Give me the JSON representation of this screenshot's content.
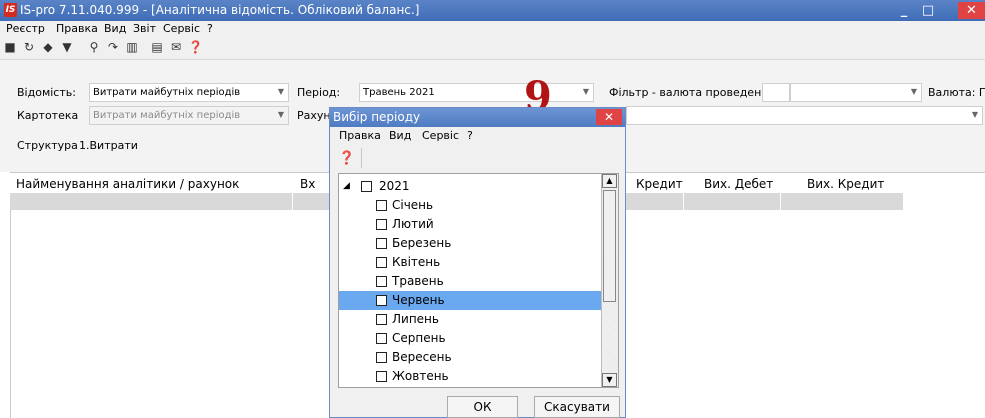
{
  "window": {
    "app_badge": "IS",
    "title": "IS-pro 7.11.040.999 - [Аналітична відомість. Обліковий баланс.]",
    "minimize": "_",
    "maximize": "□",
    "close": "✕"
  },
  "menu": [
    "Реєстр",
    "Правка",
    "Вид",
    "Звіт",
    "Сервіс",
    "?"
  ],
  "toolbar_icons": [
    "folder-icon",
    "refresh-icon",
    "filter-icon",
    "funnel-icon",
    "search-icon",
    "find-next-icon",
    "columns-icon",
    "document-icon",
    "envelope-icon",
    "help-icon"
  ],
  "form": {
    "vidomist_label": "Відомість:",
    "vidomist_value": "Витрати майбутніх періодів",
    "kartoteka_label": "Картотека",
    "kartoteka_value": "Витрати майбутніх періодів",
    "period_label": "Період:",
    "period_value": "Травень 2021",
    "rakhunok_label": "Рахун",
    "filter_label": "Фільтр - валюта проведення",
    "valuta_label": "Валюта: Г",
    "struktura_label": "Структура",
    "struktura_value": "1.Витрати"
  },
  "grid": {
    "columns": [
      "Найменування аналітики / рахунок",
      "Вх",
      "Кредит",
      "Вих. Дебет",
      "Вих. Кредит"
    ]
  },
  "annotation": "9",
  "dialog": {
    "title": "Вибір періоду",
    "close": "✕",
    "menu": [
      "Правка",
      "Вид",
      "Сервіс",
      "?"
    ],
    "help_icon": "help-icon",
    "year_toggle": "◢",
    "year": "2021",
    "months": [
      "Січень",
      "Лютий",
      "Березень",
      "Квітень",
      "Травень",
      "Червень",
      "Липень",
      "Серпень",
      "Вересень",
      "Жовтень"
    ],
    "selected_month": "Червень",
    "ok": "ОК",
    "cancel": "Скасувати",
    "scroll_up": "▲",
    "scroll_down": "▼"
  }
}
